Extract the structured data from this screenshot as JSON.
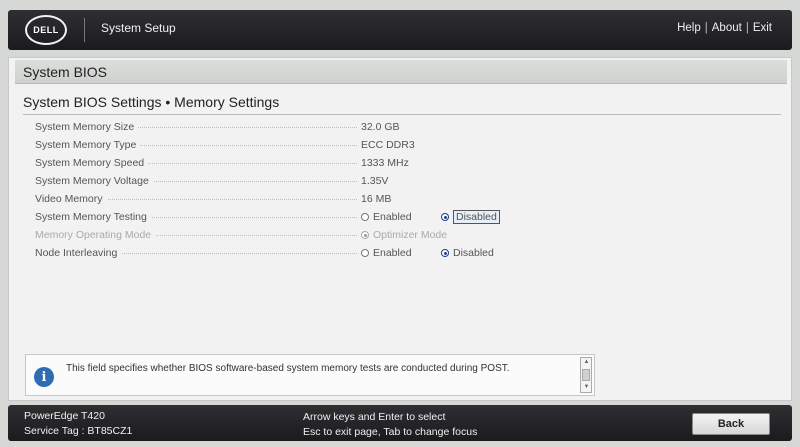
{
  "header": {
    "logo_text": "DELL",
    "app_title": "System Setup",
    "links": [
      "Help",
      "About",
      "Exit"
    ],
    "separator": "|"
  },
  "section": {
    "title": "System BIOS"
  },
  "page": {
    "title": "System BIOS Settings • Memory Settings"
  },
  "settings": [
    {
      "label": "System Memory Size",
      "value": "32.0 GB"
    },
    {
      "label": "System Memory Type",
      "value": "ECC DDR3"
    },
    {
      "label": "System Memory Speed",
      "value": "1333 MHz"
    },
    {
      "label": "System Memory Voltage",
      "value": "1.35V"
    },
    {
      "label": "Video Memory",
      "value": "16 MB"
    },
    {
      "label": "System Memory Testing",
      "options": [
        "Enabled",
        "Disabled"
      ],
      "selected": "Disabled"
    },
    {
      "label": "Memory Operating Mode",
      "options": [
        "Optimizer Mode"
      ],
      "selected": "Optimizer Mode",
      "disabled": true
    },
    {
      "label": "Node Interleaving",
      "options": [
        "Enabled",
        "Disabled"
      ],
      "selected": "Disabled"
    }
  ],
  "help": {
    "icon": "info-icon",
    "text": "This field specifies whether BIOS software-based system memory tests are conducted during POST."
  },
  "footer": {
    "model": "PowerEdge T420",
    "service_tag": "Service Tag : BT85CZ1",
    "hint_line1": "Arrow keys and Enter to select",
    "hint_line2": "Esc to exit page, Tab to change focus",
    "back_label": "Back"
  },
  "colors": {
    "header_bg": "#1b1b1e",
    "panel_bg": "#f2f2f2",
    "accent": "#2f6db3",
    "radio_selected": "#1d3d8f"
  }
}
